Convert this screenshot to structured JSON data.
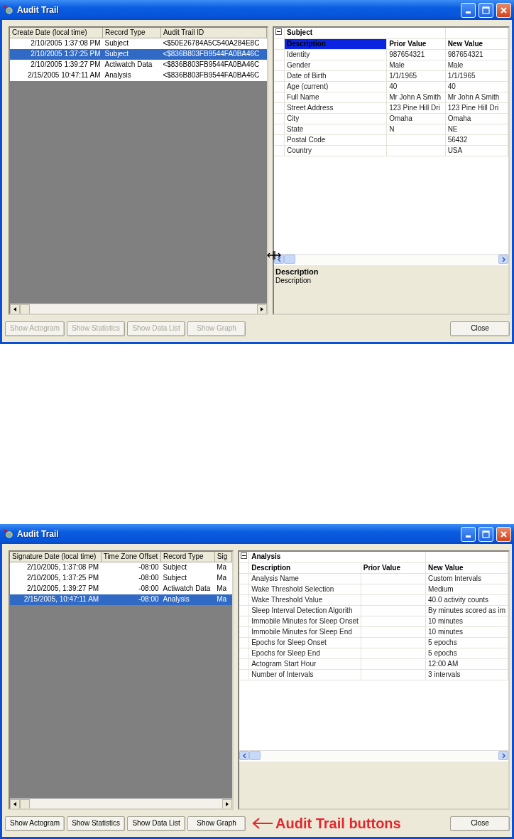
{
  "windows": [
    {
      "title": "Audit Trail",
      "resize_cursor": true,
      "list": {
        "columns": [
          "Create Date (local time)",
          "Record Type",
          "Audit Trail ID"
        ],
        "rows": [
          {
            "cells": [
              "2/10/2005 1:37:08 PM",
              "Subject",
              "<$50E26784A5C540A284E8C"
            ],
            "selected": false
          },
          {
            "cells": [
              "2/10/2005 1:37:25 PM",
              "Subject",
              "<$836B803FB9544FA0BA46C"
            ],
            "selected": true
          },
          {
            "cells": [
              "2/10/2005 1:39:27 PM",
              "Actiwatch Data",
              "<$836B803FB9544FA0BA46C"
            ],
            "selected": false
          },
          {
            "cells": [
              "2/15/2005 10:47:11 AM",
              "Analysis",
              "<$836B803FB9544FA0BA46C"
            ],
            "selected": false
          }
        ]
      },
      "properties": {
        "group": "Subject",
        "expanded": true,
        "header_selected": true,
        "columns": [
          "Description",
          "Prior Value",
          "New Value"
        ],
        "rows": [
          {
            "description": "Identity",
            "prior_value": "987654321",
            "new_value": "987654321"
          },
          {
            "description": "Gender",
            "prior_value": "Male",
            "new_value": "Male"
          },
          {
            "description": "Date of Birth",
            "prior_value": "1/1/1965",
            "new_value": "1/1/1965"
          },
          {
            "description": "Age (current)",
            "prior_value": "40",
            "new_value": "40"
          },
          {
            "description": "Full Name",
            "prior_value": "Mr John A Smith",
            "new_value": "Mr John A Smith"
          },
          {
            "description": "Street Address",
            "prior_value": "123 Pine Hill Dri",
            "new_value": "123 Pine Hill Dri"
          },
          {
            "description": "City",
            "prior_value": "Omaha",
            "new_value": "Omaha"
          },
          {
            "description": "State",
            "prior_value": "N",
            "new_value": "NE"
          },
          {
            "description": "Postal Code",
            "new_value": "56432"
          },
          {
            "description": "Country",
            "new_value": "USA"
          }
        ]
      },
      "description": {
        "title": "Description",
        "text": "Description"
      },
      "buttons": [
        {
          "label": "Show Actogram",
          "disabled": true
        },
        {
          "label": "Show Statistics",
          "disabled": true
        },
        {
          "label": "Show Data List",
          "disabled": true
        },
        {
          "label": "Show Graph",
          "disabled": true
        }
      ],
      "close_button": "Close"
    },
    {
      "title": "Audit Trail",
      "list": {
        "columns": [
          "Signature Date (local time)",
          "Time Zone Offset",
          "Record Type",
          "Sig"
        ],
        "rows": [
          {
            "cells": [
              "2/10/2005, 1:37:08 PM",
              "-08:00",
              "Subject",
              "Ma"
            ],
            "selected": false
          },
          {
            "cells": [
              "2/10/2005, 1:37:25 PM",
              "-08:00",
              "Subject",
              "Ma"
            ],
            "selected": false
          },
          {
            "cells": [
              "2/10/2005, 1:39:27 PM",
              "-08:00",
              "Actiwatch Data",
              "Ma"
            ],
            "selected": false
          },
          {
            "cells": [
              "2/15/2005, 10:47:11 AM",
              "-08:00",
              "Analysis",
              "Ma"
            ],
            "selected": true
          }
        ]
      },
      "properties": {
        "group": "Analysis",
        "expanded": true,
        "header_selected": false,
        "columns": [
          "Description",
          "Prior Value",
          "New Value"
        ],
        "rows": [
          {
            "description": "Analysis Name",
            "new_value": "Custom Intervals"
          },
          {
            "description": "Wake Threshold Selection",
            "new_value": "Medium"
          },
          {
            "description": "Wake Threshold Value",
            "new_value": "40.0 activity counts"
          },
          {
            "description": "Sleep Interval Detection Algorith",
            "new_value": "By minutes scored as im"
          },
          {
            "description": "Immobile Minutes for Sleep Onset",
            "new_value": "10 minutes"
          },
          {
            "description": "Immobile Minutes for Sleep End",
            "new_value": "10 minutes"
          },
          {
            "description": "Epochs for Sleep Onset",
            "new_value": "5 epochs"
          },
          {
            "description": "Epochs for Sleep End",
            "new_value": "5 epochs"
          },
          {
            "description": "Actogram Start Hour",
            "new_value": "12:00 AM"
          },
          {
            "description": "Number of Intervals",
            "new_value": "3 intervals"
          }
        ]
      },
      "buttons": [
        {
          "label": "Show Actogram",
          "disabled": false
        },
        {
          "label": "Show Statistics",
          "disabled": false
        },
        {
          "label": "Show Data List",
          "disabled": false
        },
        {
          "label": "Show Graph",
          "disabled": false
        }
      ],
      "annotation": "Audit Trail buttons",
      "close_button": "Close"
    }
  ]
}
